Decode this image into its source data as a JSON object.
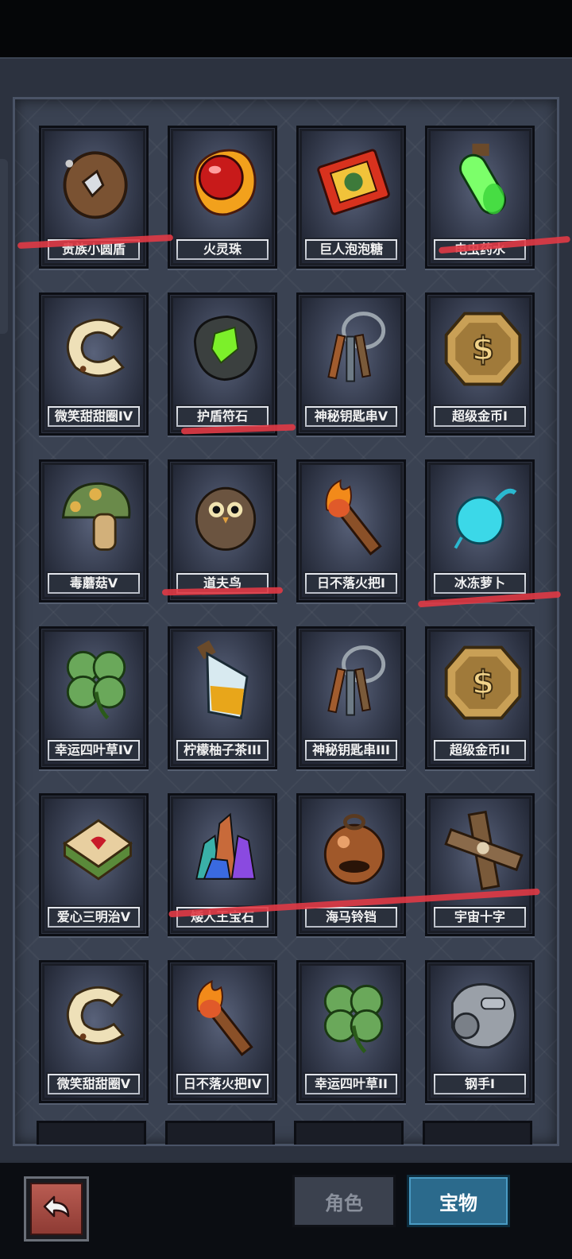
{
  "tabs": {
    "role": "角色",
    "treasure": "宝物",
    "active": "treasure"
  },
  "items": [
    {
      "name": "贵族小圆盾",
      "icon": "wooden-shield-icon"
    },
    {
      "name": "火灵珠",
      "icon": "fire-orb-icon"
    },
    {
      "name": "巨人泡泡糖",
      "icon": "bubblegum-pack-icon"
    },
    {
      "name": "电虫药水",
      "icon": "green-potion-icon"
    },
    {
      "name": "微笑甜甜圈IV",
      "icon": "donut-icon"
    },
    {
      "name": "护盾符石",
      "icon": "rune-stone-icon"
    },
    {
      "name": "神秘钥匙串V",
      "icon": "key-ring-icon"
    },
    {
      "name": "超级金币I",
      "icon": "gold-coin-icon"
    },
    {
      "name": "毒蘑菇V",
      "icon": "mushroom-icon"
    },
    {
      "name": "道夫鸟",
      "icon": "owl-bird-icon"
    },
    {
      "name": "日不落火把I",
      "icon": "torch-icon"
    },
    {
      "name": "冰冻萝卜",
      "icon": "ice-radish-icon"
    },
    {
      "name": "幸运四叶草IV",
      "icon": "four-leaf-clover-icon"
    },
    {
      "name": "柠檬柚子茶III",
      "icon": "tea-bottle-icon"
    },
    {
      "name": "神秘钥匙串III",
      "icon": "key-ring-icon"
    },
    {
      "name": "超级金币II",
      "icon": "gold-coin-icon"
    },
    {
      "name": "爱心三明治V",
      "icon": "sandwich-icon"
    },
    {
      "name": "矮人王宝石",
      "icon": "crystal-cluster-icon"
    },
    {
      "name": "海马铃铛",
      "icon": "bell-icon"
    },
    {
      "name": "宇宙十字",
      "icon": "wooden-cross-icon"
    },
    {
      "name": "微笑甜甜圈V",
      "icon": "donut-icon"
    },
    {
      "name": "日不落火把IV",
      "icon": "torch-icon"
    },
    {
      "name": "幸运四叶草II",
      "icon": "four-leaf-clover-icon"
    },
    {
      "name": "钢手I",
      "icon": "steel-gauntlet-icon"
    }
  ],
  "icons": {
    "back": "back-arrow-icon"
  },
  "colors": {
    "annotation": "#e03a45",
    "active_tab": "#2b6a8c"
  }
}
